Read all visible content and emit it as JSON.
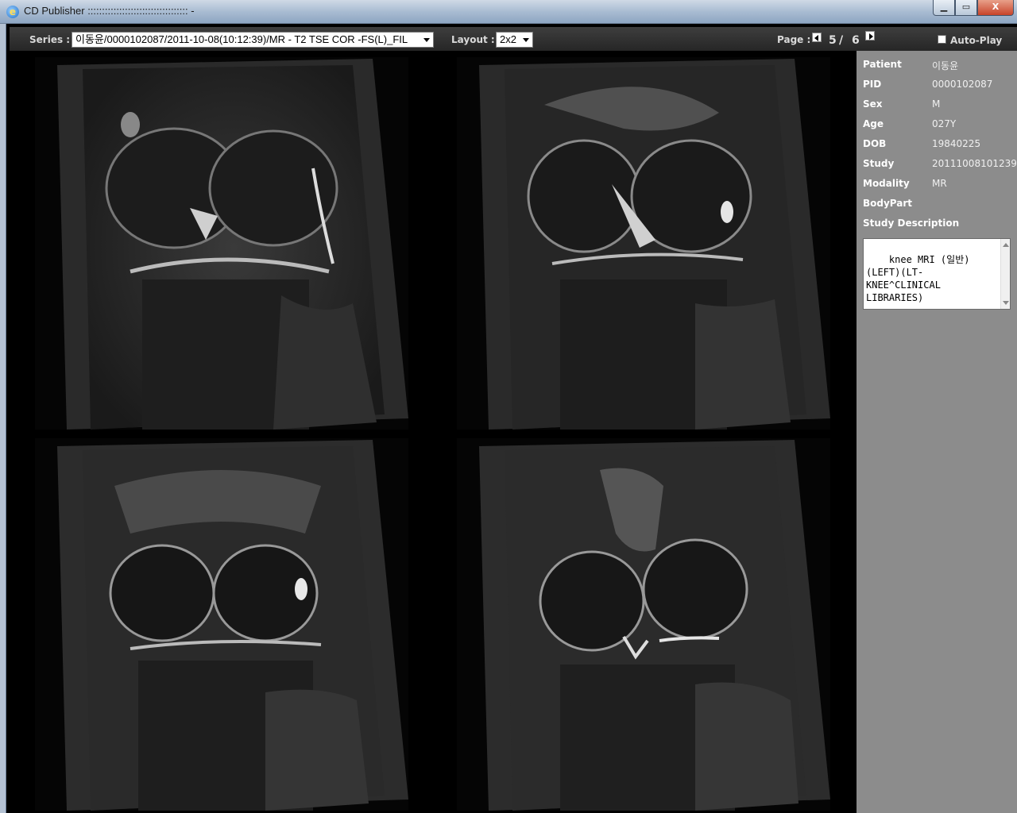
{
  "window": {
    "title": "CD Publisher ::::::::::::::::::::::::::::::::::: -",
    "minimize_symbol": "▁",
    "maximize_symbol": "▭",
    "close_symbol": "X"
  },
  "toolbar": {
    "series_label": "Series :",
    "series_value": "이동윤/0000102087/2011-10-08(10:12:39)/MR - T2 TSE COR -FS(L)_FIL",
    "layout_label": "Layout :",
    "layout_value": "2x2",
    "page_label": "Page :",
    "page_current": "5",
    "page_separator": "/",
    "page_total": "6",
    "autoplay_label": "Auto-Play",
    "autoplay_checked": false
  },
  "viewer": {
    "layout": "2x2",
    "images": [
      {
        "name": "mri-slice-1",
        "content": "coronal knee MRI slice"
      },
      {
        "name": "mri-slice-2",
        "content": "coronal knee MRI slice"
      },
      {
        "name": "mri-slice-3",
        "content": "coronal knee MRI slice"
      },
      {
        "name": "mri-slice-4",
        "content": "coronal knee MRI slice"
      }
    ]
  },
  "info": {
    "patient_label": "Patient",
    "patient_value": "이동윤",
    "pid_label": "PID",
    "pid_value": "0000102087",
    "sex_label": "Sex",
    "sex_value": "M",
    "age_label": "Age",
    "age_value": "027Y",
    "dob_label": "DOB",
    "dob_value": "19840225",
    "study_label": "Study",
    "study_value": "20111008101239",
    "modality_label": "Modality",
    "modality_value": "MR",
    "bodypart_label": "BodyPart",
    "bodypart_value": "",
    "study_desc_label": "Study Description",
    "study_desc_value": "knee MRI (일반)\n(LEFT)(LT-\nKNEE^CLINICAL\nLIBRARIES)"
  },
  "colors": {
    "toolbar_bg": "#2e2e2e",
    "panel_bg": "#8c8c8c",
    "viewer_bg": "#000000"
  }
}
